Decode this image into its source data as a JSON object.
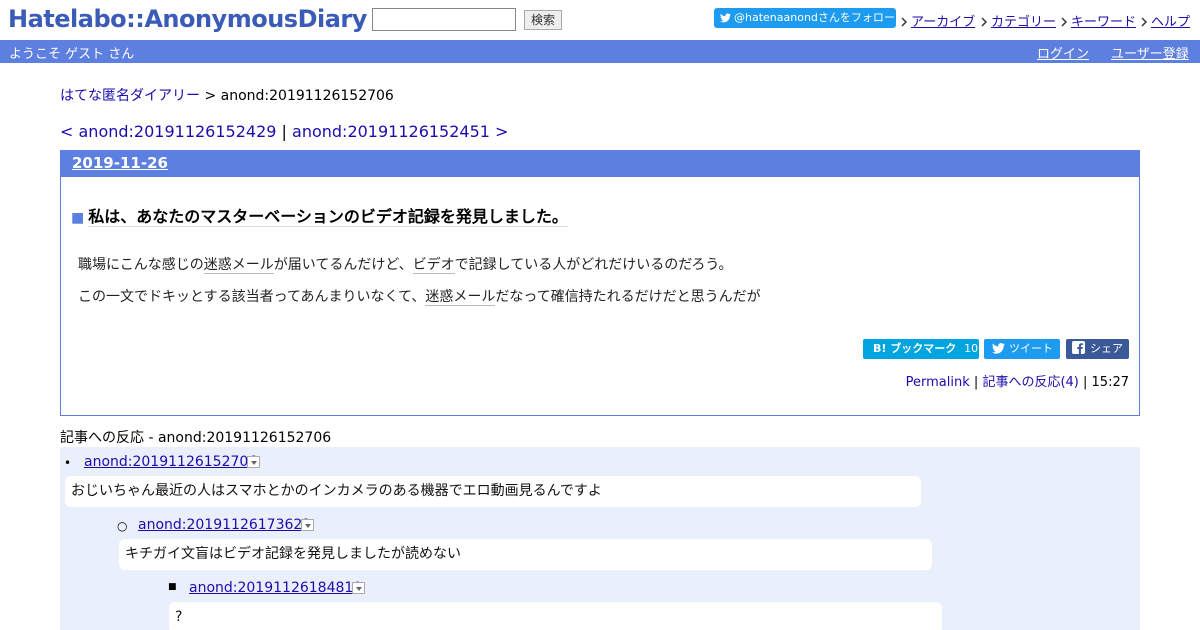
{
  "header": {
    "logo": "Hatelabo::AnonymousDiary",
    "search_value": "",
    "search_button": "検索",
    "follow_button": "@hatenaanondさんをフォロー",
    "nav": [
      "アーカイブ",
      "カテゴリー",
      "キーワード",
      "ヘルプ"
    ]
  },
  "welcome": {
    "text": "ようこそ ゲスト さん",
    "login": "ログイン",
    "signup": "ユーザー登録"
  },
  "breadcrumb": {
    "home": "はてな匿名ダイアリー",
    "separator": ">",
    "current": "anond:20191126152706"
  },
  "pager": {
    "prev": "< anond:20191126152429",
    "separator": "|",
    "next": "anond:20191126152451 >"
  },
  "entry": {
    "date": "2019-11-26",
    "title_marker": "■",
    "title": "私は、あなたのマスターベーションのビデオ記録を発見しました。",
    "p1": {
      "a": "職場にこんな感じの",
      "kw1": "迷惑メール",
      "b": "が届いてるんだけど、",
      "kw2": "ビデオ",
      "c": "で記録している人がどれだけいるのだろう。"
    },
    "p2": {
      "a": "この一文でドキッとする該当者ってあんまりいなくて、",
      "kw1": "迷惑メール",
      "b": "だなって確信持たれるだけだと思うんだが"
    },
    "share": {
      "bookmark": "B! ブックマーク",
      "bookmark_count": "10",
      "tweet": "ツイート",
      "facebook": "シェア"
    },
    "footer": {
      "permalink": "Permalink",
      "separator": "|",
      "reactions": "記事への反応(4)",
      "time": "15:27"
    }
  },
  "reactions": {
    "title": "記事への反応 - anond:20191126152706",
    "items": [
      {
        "bullet": "•",
        "id": "anond:20191126152706",
        "body": "おじいちゃん最近の人はスマホとかのインカメラのある機器でエロ動画見るんですよ"
      },
      {
        "bullet": "○",
        "id": "anond:20191126173622",
        "body": "キチガイ文盲はビデオ記録を発見しましたが読めない"
      },
      {
        "bullet": "■",
        "id": "anond:20191126184810",
        "body": "?"
      }
    ]
  },
  "colors": {
    "accent": "#5d7fe0",
    "link": "#1a0dab",
    "reaction_bg": "#eaeffc",
    "twitter": "#1d9bf0",
    "hatebu": "#00a4de",
    "facebook": "#3b5998"
  },
  "icons": [
    "twitter-bird-icon",
    "nav-arrow-icon",
    "facebook-icon",
    "dropdown-icon"
  ]
}
